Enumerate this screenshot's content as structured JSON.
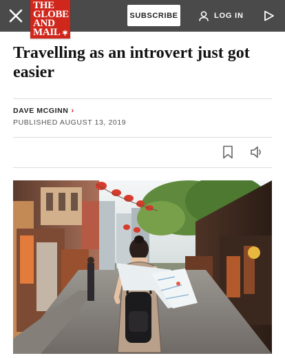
{
  "topbar": {
    "close_icon": "close-icon",
    "logo_lines": [
      "THE",
      "GLOBE",
      "AND",
      "MAIL"
    ],
    "subscribe_label": "SUBSCRIBE",
    "login_label": "LOG IN",
    "login_icon": "user-icon",
    "play_icon": "play-icon",
    "bar_color": "#4a4a4a",
    "logo_color": "#d0271d"
  },
  "article": {
    "headline": "Travelling as an introvert just got easier",
    "author": "DAVE MCGINN",
    "author_chevron": "›",
    "published": "PUBLISHED AUGUST 13, 2019",
    "bookmark_icon": "bookmark-icon",
    "audio_icon": "speaker-icon"
  },
  "photo": {
    "subject": "woman-with-backpack-reading-map-on-street"
  }
}
